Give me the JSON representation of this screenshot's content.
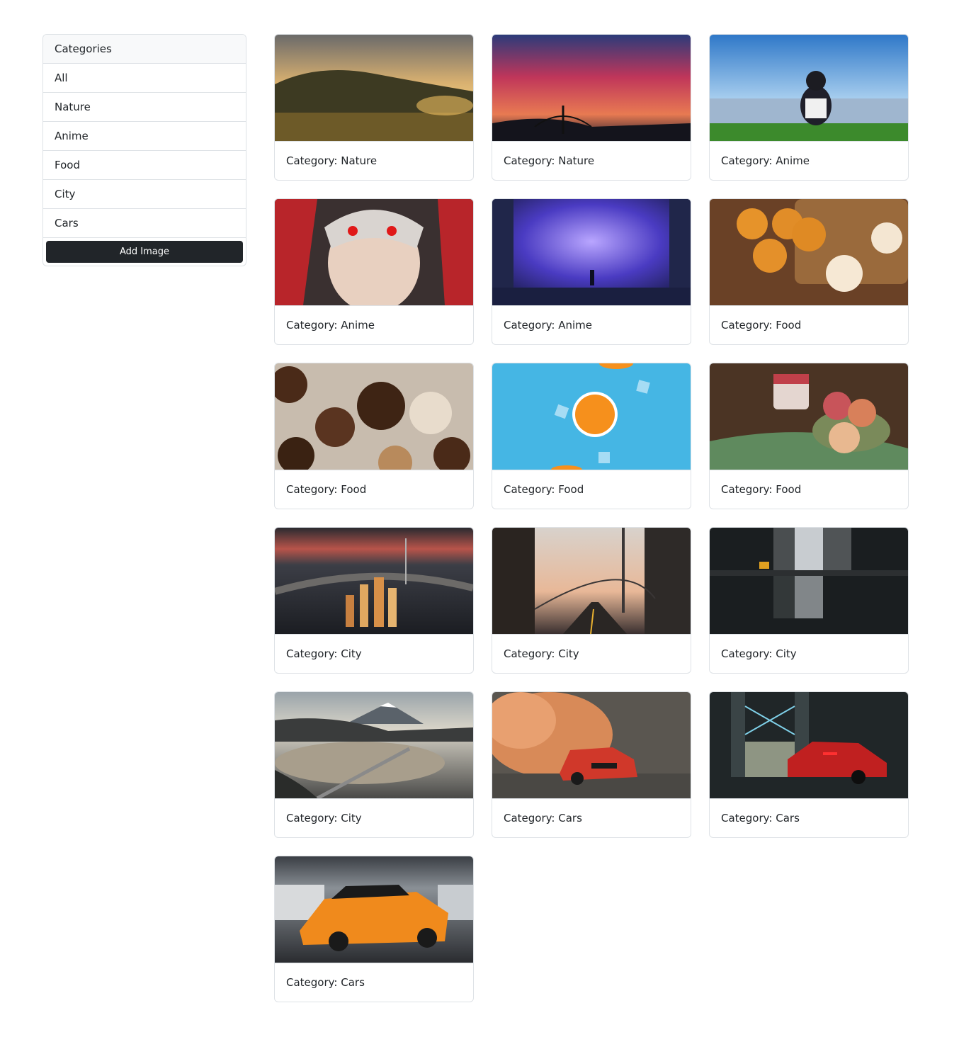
{
  "sidebar": {
    "header": "Categories",
    "items": [
      "All",
      "Nature",
      "Anime",
      "Food",
      "City",
      "Cars"
    ],
    "add_button": "Add Image"
  },
  "cards": [
    {
      "label": "Category: Nature",
      "scene": "nature-field-sunrise"
    },
    {
      "label": "Category: Nature",
      "scene": "nature-bridge-sunset"
    },
    {
      "label": "Category: Anime",
      "scene": "anime-girl-city"
    },
    {
      "label": "Category: Anime",
      "scene": "anime-red-eyes"
    },
    {
      "label": "Category: Anime",
      "scene": "anime-cosmic-room"
    },
    {
      "label": "Category: Food",
      "scene": "food-pears-apple"
    },
    {
      "label": "Category: Food",
      "scene": "food-chocolate-pops"
    },
    {
      "label": "Category: Food",
      "scene": "food-orange-slices"
    },
    {
      "label": "Category: Food",
      "scene": "food-peaches-jar"
    },
    {
      "label": "Category: City",
      "scene": "city-aerial-night"
    },
    {
      "label": "Category: City",
      "scene": "city-bridge-street"
    },
    {
      "label": "Category: City",
      "scene": "city-puddle-reflection"
    },
    {
      "label": "Category: City",
      "scene": "city-mount-fuji"
    },
    {
      "label": "Category: Cars",
      "scene": "cars-red-bmw-smoke"
    },
    {
      "label": "Category: Cars",
      "scene": "cars-red-lambo-bridge"
    },
    {
      "label": "Category: Cars",
      "scene": "cars-orange-racecar"
    }
  ]
}
